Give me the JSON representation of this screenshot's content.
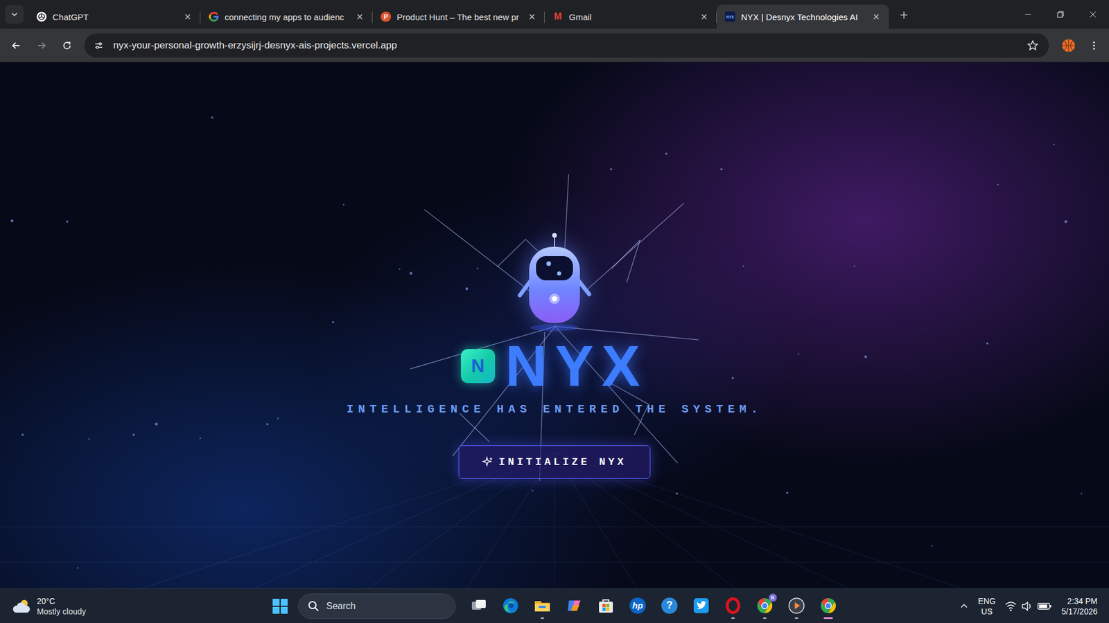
{
  "browser": {
    "tabs": [
      {
        "kind": "chatgpt",
        "label": "ChatGPT",
        "selected": false
      },
      {
        "kind": "google",
        "label": "connecting my apps to audienc",
        "selected": false
      },
      {
        "kind": "producthunt",
        "label": "Product Hunt – The best new pr",
        "favicon_text": "P",
        "selected": false
      },
      {
        "kind": "gmail",
        "label": "Gmail",
        "favicon_text": "M",
        "selected": false
      },
      {
        "kind": "nyx",
        "label": "NYX | Desnyx Technologies AI",
        "favicon_text": "NYX",
        "selected": true
      }
    ],
    "address": "nyx-your-personal-growth-erzysijrj-desnyx-ais-projects.vercel.app"
  },
  "page": {
    "logo_letter": "N",
    "title": "NYX",
    "tagline": "INTELLIGENCE HAS ENTERED THE SYSTEM.",
    "button": "INITIALIZE NYX"
  },
  "taskbar": {
    "weather": {
      "temperature": "20°C",
      "condition": "Mostly cloudy"
    },
    "search": "Search",
    "apps": [
      {
        "kind": "task-view",
        "running": false,
        "active": false
      },
      {
        "kind": "edge",
        "running": false,
        "active": false
      },
      {
        "kind": "explorer",
        "running": true,
        "active": false
      },
      {
        "kind": "copilot",
        "running": false,
        "active": false
      },
      {
        "kind": "store",
        "running": false,
        "active": false
      },
      {
        "kind": "hp",
        "text": "hp",
        "running": false,
        "active": false
      },
      {
        "kind": "help",
        "text": "?",
        "running": false,
        "active": false
      },
      {
        "kind": "twitter",
        "running": false,
        "active": false
      },
      {
        "kind": "opera",
        "running": true,
        "active": false
      },
      {
        "kind": "chrome",
        "badge": "K",
        "running": true,
        "active": false
      },
      {
        "kind": "media",
        "running": true,
        "active": false
      },
      {
        "kind": "chrome",
        "running": true,
        "active": true
      }
    ],
    "tray": {
      "language": "ENG",
      "region": "US",
      "time": "2:34 PM",
      "date": "5/17/2026"
    }
  }
}
